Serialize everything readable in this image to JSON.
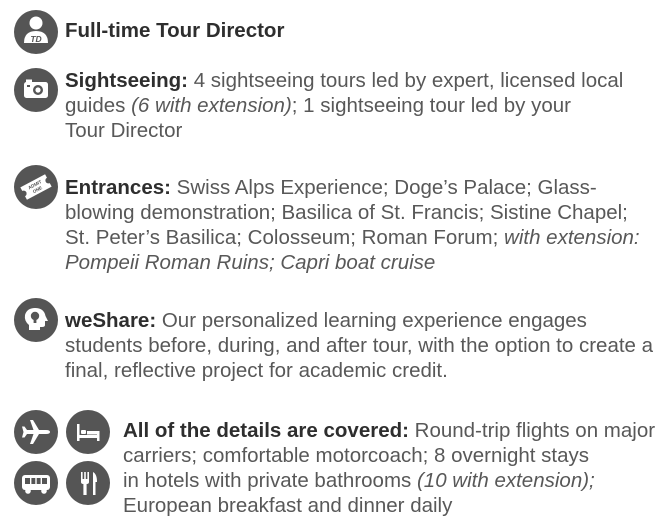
{
  "items": [
    {
      "id": "tour-director",
      "icon": "tour-director-badge-icon",
      "icon_text": "TD",
      "lead": "Full-time Tour Director"
    },
    {
      "id": "sightseeing",
      "icon": "camera-icon",
      "lead": "Sightseeing:",
      "lines": [
        " 4 sightseeing tours led by expert, licensed local",
        [
          "guides ",
          "(6 with extension)",
          "; 1 sightseeing tour led by your"
        ],
        "Tour Director"
      ]
    },
    {
      "id": "entrances",
      "icon": "admit-one-ticket-icon",
      "icon_text": "ADMIT ONE",
      "lead": "Entrances:",
      "lines": [
        " Swiss Alps Experience; Doge’s Palace; Glass-",
        "blowing demonstration; Basilica of St. Francis; Sistine Chapel;",
        [
          "St. Peter’s Basilica; Colosseum; Roman Forum; ",
          "with extension:"
        ],
        "Pompeii Roman Ruins; Capri boat cruise"
      ]
    },
    {
      "id": "weshare",
      "icon": "head-lightbulb-icon",
      "lead": "weShare:",
      "lines": [
        " Our personalized learning experience engages",
        "students before, during, and after tour, with the option to create a",
        "final, reflective project for academic credit."
      ]
    },
    {
      "id": "details",
      "icons": [
        "airplane-icon",
        "bed-icon",
        "bus-icon",
        "fork-knife-icon"
      ],
      "lead": "All of the details are covered:",
      "lines": [
        " Round-trip flights on major",
        "carriers; comfortable motorcoach; 8 overnight stays",
        [
          "in hotels with private bathrooms ",
          "(10 with extension);"
        ],
        "European breakfast and dinner daily"
      ]
    }
  ],
  "colors": {
    "icon_bg": "#555555",
    "lead_text": "#2e2e2e",
    "body_text": "#585858"
  }
}
